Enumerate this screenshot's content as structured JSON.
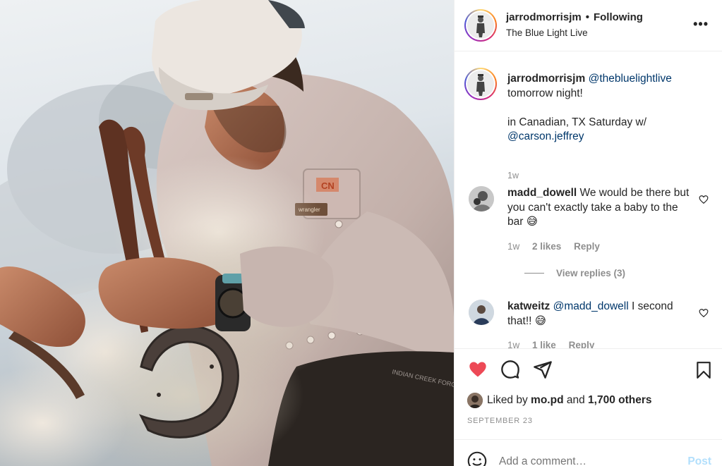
{
  "post": {
    "author": "jarrodmorrisjm",
    "follow_status": "Following",
    "location": "The Blue Light Live",
    "more_icon": "more-horizontal-icon"
  },
  "caption": {
    "username": "jarrodmorrisjm",
    "mention": "@thebluelightlive",
    "line1": "tomorrow night!",
    "line2": "in Canadian, TX Saturday w/",
    "mention2": "@carson.jeffrey",
    "time": "1w"
  },
  "comments": [
    {
      "username": "madd_dowell",
      "text": "We would be there but you can't exactly take a baby to the bar",
      "emoji": "😅",
      "time": "1w",
      "likes": "2 likes",
      "reply": "Reply",
      "view_replies": "View replies (3)"
    },
    {
      "username": "katweitz",
      "mention": "@madd_dowell",
      "text": "I second that!!",
      "emoji": "😅",
      "time": "1w",
      "likes": "1 like",
      "reply": "Reply"
    }
  ],
  "actions": {
    "liked_prefix": "Liked by",
    "liked_user": "mo.pd",
    "liked_and": "and",
    "liked_others": "1,700 others",
    "date": "SEPTEMBER 23",
    "comment_placeholder": "Add a comment…",
    "post_label": "Post",
    "like_color": "#ed4956",
    "post_color": "#b2dffc"
  },
  "photo": {
    "shirt_patch": "CN",
    "shirt_tag": "wrangler",
    "apron_text": "INDIAN CREEK FORGE"
  }
}
